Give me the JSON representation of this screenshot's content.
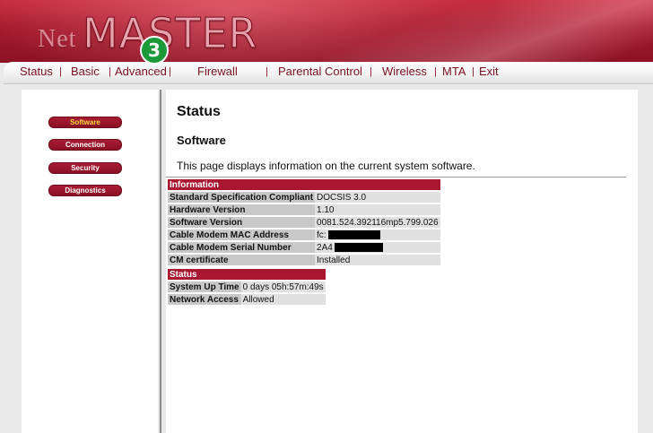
{
  "brand": {
    "prefix": "Net",
    "name": "MASTER"
  },
  "step_badge": "3",
  "nav": [
    {
      "label": "Status"
    },
    {
      "label": "Basic"
    },
    {
      "label": "Advanced"
    },
    {
      "label": "Firewall"
    },
    {
      "label": "Parental Control"
    },
    {
      "label": "Wireless"
    },
    {
      "label": "MTA"
    },
    {
      "label": "Exit"
    }
  ],
  "sidebar": {
    "items": [
      {
        "label": "Software",
        "active": true
      },
      {
        "label": "Connection",
        "active": false
      },
      {
        "label": "Security",
        "active": false
      },
      {
        "label": "Diagnostics",
        "active": false
      }
    ]
  },
  "main": {
    "title": "Status",
    "subtitle": "Software",
    "description": "This page displays information on the current system software.",
    "information": {
      "header": "Information",
      "rows": [
        {
          "label": "Standard Specification Compliant",
          "value": "DOCSIS 3.0"
        },
        {
          "label": "Hardware Version",
          "value": "1.10"
        },
        {
          "label": "Software Version",
          "value": "0081.524.392116mp5.799.026"
        },
        {
          "label": "Cable Modem MAC Address",
          "value": "fc:"
        },
        {
          "label": "Cable Modem Serial Number",
          "value": "2A4"
        },
        {
          "label": "CM certificate",
          "value": "Installed"
        }
      ]
    },
    "status": {
      "header": "Status",
      "rows": [
        {
          "label": "System Up Time",
          "value": "0 days 05h:57m:49s"
        },
        {
          "label": "Network Access",
          "value": "Allowed"
        }
      ]
    }
  },
  "colors": {
    "brand_red": "#a8162f",
    "badge_green": "#1c9a3a",
    "active_link": "#ffd83a"
  }
}
